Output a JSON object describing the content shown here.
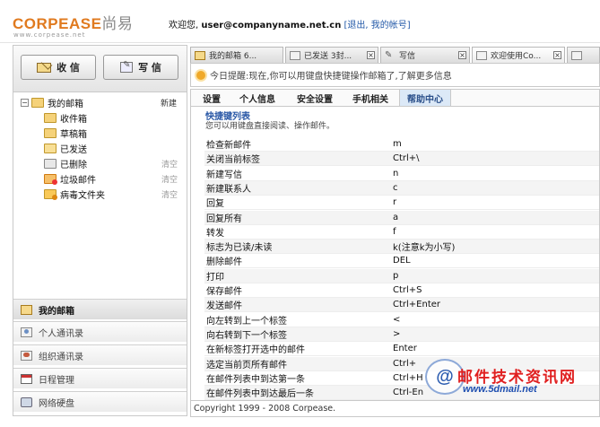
{
  "brand": {
    "logo_main": "CORPEASE",
    "logo_cn": "尚易",
    "logo_sub": "www.corpease.net"
  },
  "header": {
    "welcome": "欢迎您,",
    "user": "user@companyname.net.cn",
    "links": "[退出, 我的帐号]"
  },
  "compose": {
    "receive_label": "收 信",
    "write_label": "写 信"
  },
  "tree": {
    "root_label": "我的邮箱",
    "root_action": "新建",
    "folders": [
      {
        "label": "收件箱",
        "action": ""
      },
      {
        "label": "草稿箱",
        "action": ""
      },
      {
        "label": "已发送",
        "action": ""
      },
      {
        "label": "已删除",
        "action": "清空"
      },
      {
        "label": "垃圾邮件",
        "action": "清空"
      },
      {
        "label": "病毒文件夹",
        "action": "清空"
      }
    ]
  },
  "leftnav": [
    {
      "label": "我的邮箱",
      "icon": "mailbox-icon"
    },
    {
      "label": "个人通讯录",
      "icon": "contact-icon"
    },
    {
      "label": "组织通讯录",
      "icon": "org-contacts-icon"
    },
    {
      "label": "日程管理",
      "icon": "calendar-icon"
    },
    {
      "label": "网络硬盘",
      "icon": "disk-icon"
    }
  ],
  "tabs": [
    {
      "label": "我的邮箱 6..."
    },
    {
      "label": "已发送 3封..."
    },
    {
      "label": "写信"
    },
    {
      "label": "欢迎使用Co..."
    },
    {
      "label": ""
    }
  ],
  "notice": "今日提醒:现在,你可以用键盘快捷键操作邮箱了,了解更多信息",
  "subtabs": [
    "设置",
    "个人信息",
    "安全设置",
    "手机相关",
    "帮助中心"
  ],
  "section": {
    "title": "快捷键列表",
    "desc": "您可以用键盘直接阅读、操作邮件。"
  },
  "shortcuts": [
    {
      "action": "检查新邮件",
      "key": "m"
    },
    {
      "action": "关闭当前标签",
      "key": "Ctrl+\\"
    },
    {
      "action": "新建写信",
      "key": "n"
    },
    {
      "action": "新建联系人",
      "key": "c"
    },
    {
      "action": "回复",
      "key": "r"
    },
    {
      "action": "回复所有",
      "key": "a"
    },
    {
      "action": "转发",
      "key": "f"
    },
    {
      "action": "标志为已读/未读",
      "key": "k(注意k为小写)"
    },
    {
      "action": "删除邮件",
      "key": "DEL"
    },
    {
      "action": "打印",
      "key": "p"
    },
    {
      "action": "保存邮件",
      "key": "Ctrl+S"
    },
    {
      "action": "发送邮件",
      "key": "Ctrl+Enter"
    },
    {
      "action": "向左转到上一个标签",
      "key": "<"
    },
    {
      "action": "向右转到下一个标签",
      "key": ">"
    },
    {
      "action": "在新标签打开选中的邮件",
      "key": "Enter"
    },
    {
      "action": "选定当前页所有邮件",
      "key": "Ctrl+"
    },
    {
      "action": "在邮件列表中到达第一条",
      "key": "Ctrl+H"
    },
    {
      "action": "在邮件列表中到达最后一条",
      "key": "Ctrl-En"
    }
  ],
  "footer": "Copyright 1999 - 2008 Corpease.",
  "watermark": {
    "glyph": "@",
    "title": "邮件技术资讯网",
    "url": "www.5dmail.net"
  }
}
